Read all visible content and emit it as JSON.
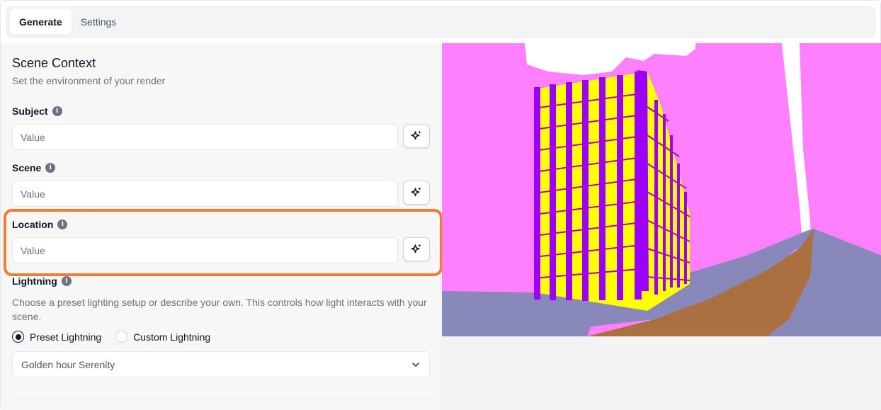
{
  "tabs": [
    {
      "label": "Generate",
      "active": true
    },
    {
      "label": "Settings",
      "active": false
    }
  ],
  "scene_context": {
    "title": "Scene Context",
    "subtitle": "Set the environment of your render"
  },
  "fields": {
    "subject": {
      "label": "Subject",
      "placeholder": "Value"
    },
    "scene": {
      "label": "Scene",
      "placeholder": "Value"
    },
    "location": {
      "label": "Location",
      "placeholder": "Value"
    }
  },
  "lightning": {
    "label": "Lightning",
    "description": "Choose a preset lighting setup or describe your own. This controls how light interacts with your scene.",
    "options": [
      {
        "label": "Preset Lightning",
        "checked": true
      },
      {
        "label": "Custom Lightning",
        "checked": false
      }
    ],
    "selected_preset": "Golden hour Serenity"
  },
  "icons": {
    "info": "info-icon",
    "magic": "sparkles-icon",
    "dropdown": "chevron-down-icon"
  },
  "colors": {
    "highlight": "#f47c2c",
    "sky": "#ff80ff",
    "building": "#ffff00",
    "frame": "#9900ff",
    "road": "#aa7040",
    "sidewalk": "#8888bb"
  }
}
